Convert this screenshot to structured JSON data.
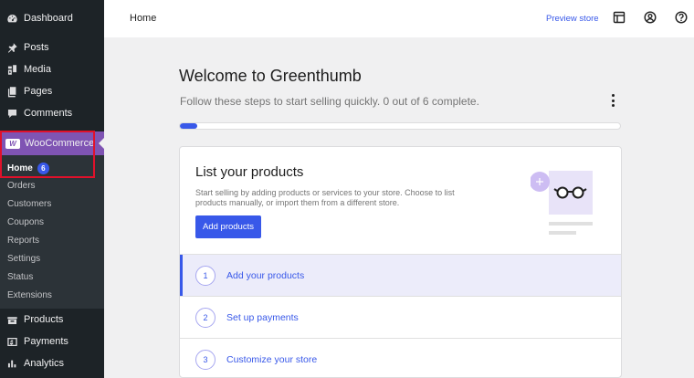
{
  "sidebar": {
    "items": [
      {
        "label": "Dashboard",
        "icon": "dashboard-icon"
      },
      {
        "label": "Posts",
        "icon": "pin-icon"
      },
      {
        "label": "Media",
        "icon": "media-icon"
      },
      {
        "label": "Pages",
        "icon": "pages-icon"
      },
      {
        "label": "Comments",
        "icon": "comment-icon"
      },
      {
        "label": "WooCommerce",
        "icon": "woocommerce-logo"
      },
      {
        "label": "Products",
        "icon": "products-icon"
      },
      {
        "label": "Payments",
        "icon": "payments-icon"
      },
      {
        "label": "Analytics",
        "icon": "analytics-icon"
      }
    ],
    "submenu": {
      "home_label": "Home",
      "home_badge": "6",
      "items": [
        "Orders",
        "Customers",
        "Coupons",
        "Reports",
        "Settings",
        "Status",
        "Extensions"
      ]
    },
    "woo_logo_text": "W"
  },
  "header": {
    "title": "Home",
    "preview_link": "Preview store",
    "icons": [
      "layout-icon",
      "account-icon",
      "help-icon"
    ]
  },
  "main": {
    "welcome_title": "Welcome to Greenthumb",
    "welcome_subtitle": "Follow these steps to start selling quickly. 0 out of 6 complete.",
    "progress_fraction": 0.04,
    "card": {
      "title": "List your products",
      "description": "Start selling by adding products or services to your store. Choose to list products manually, or import them from a different store.",
      "button_label": "Add products"
    },
    "steps": [
      {
        "number": "1",
        "label": "Add your products"
      },
      {
        "number": "2",
        "label": "Set up payments"
      },
      {
        "number": "3",
        "label": "Customize your store"
      }
    ]
  },
  "colors": {
    "accent": "#3858e9",
    "woo_purple": "#7f54b3",
    "sidebar_bg": "#1d2327",
    "highlight_red": "#e0112b"
  }
}
